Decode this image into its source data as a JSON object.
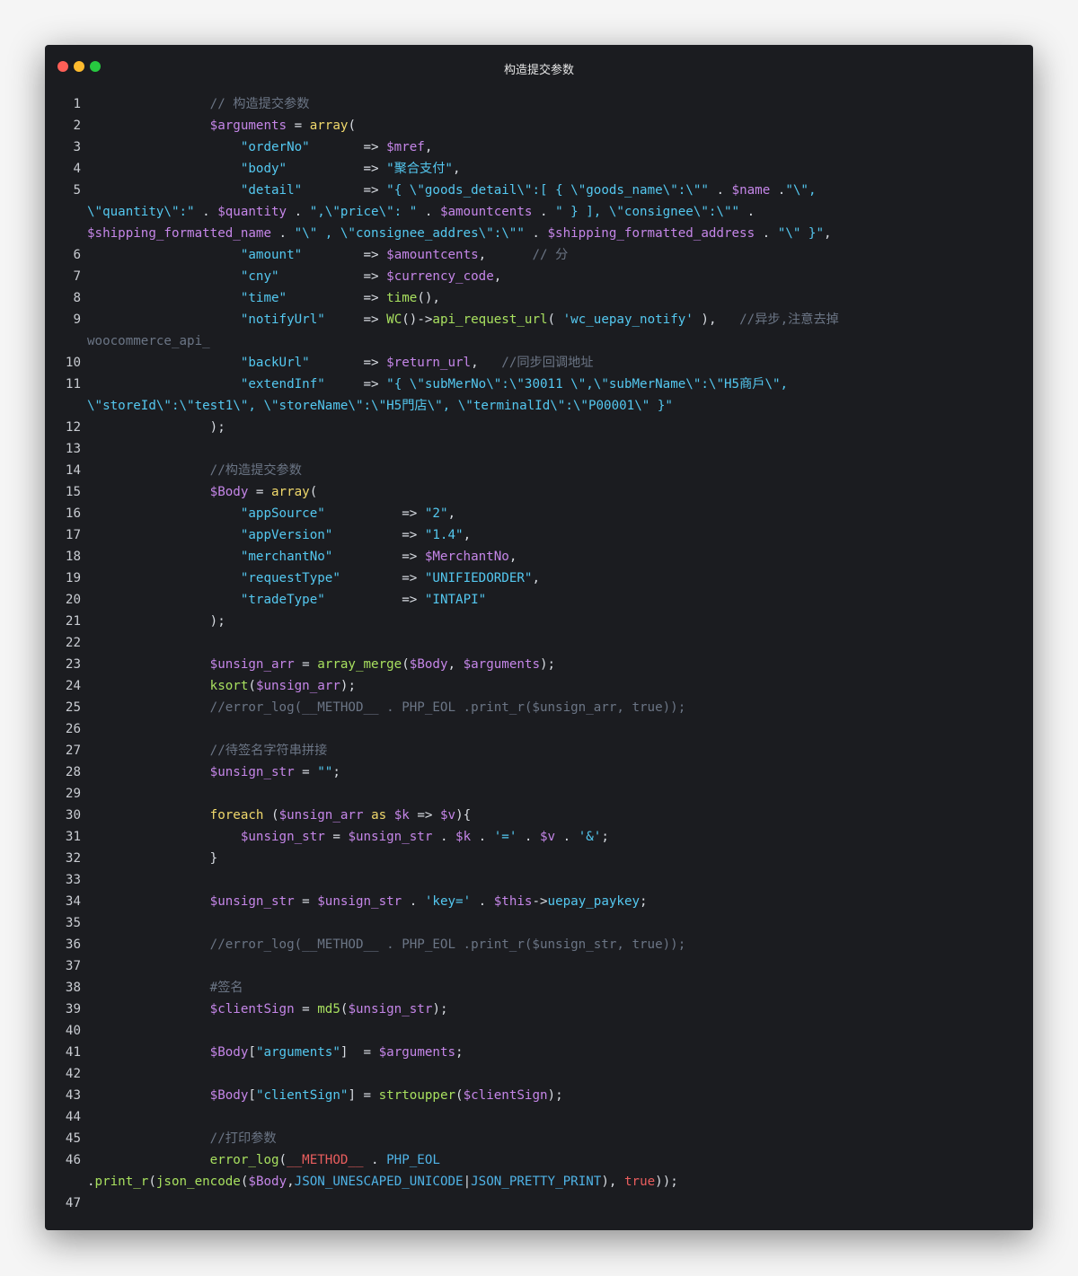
{
  "window": {
    "title": "构造提交参数",
    "colors": {
      "close": "#fe5f57",
      "minimize": "#febb2e",
      "maximize": "#27c840",
      "background": "#1b1c20"
    }
  },
  "code_lines": [
    {
      "n": "1",
      "tokens": [
        [
          "",
          "                "
        ],
        [
          "c",
          "// 构造提交参数"
        ]
      ]
    },
    {
      "n": "2",
      "tokens": [
        [
          "",
          "                "
        ],
        [
          "v",
          "$arguments"
        ],
        [
          "o",
          " = "
        ],
        [
          "k",
          "array"
        ],
        [
          "o",
          "("
        ]
      ]
    },
    {
      "n": "3",
      "tokens": [
        [
          "",
          "                    "
        ],
        [
          "s",
          "\"orderNo\""
        ],
        [
          "o",
          "       => "
        ],
        [
          "v",
          "$mref"
        ],
        [
          "o",
          ","
        ]
      ]
    },
    {
      "n": "4",
      "tokens": [
        [
          "",
          "                    "
        ],
        [
          "s",
          "\"body\""
        ],
        [
          "o",
          "          => "
        ],
        [
          "s",
          "\"聚合支付\""
        ],
        [
          "o",
          ","
        ]
      ]
    },
    {
      "n": "5",
      "tokens": [
        [
          "",
          "                    "
        ],
        [
          "s",
          "\"detail\""
        ],
        [
          "o",
          "        => "
        ],
        [
          "s",
          "\"{ \\\"goods_detail\\\":[ { \\\"goods_name\\\":\\\"\""
        ],
        [
          "o",
          " . "
        ],
        [
          "v",
          "$name"
        ],
        [
          "o",
          " ."
        ],
        [
          "s",
          "\"\\\","
        ]
      ]
    },
    {
      "n": "",
      "tokens": [
        [
          "s",
          "\\\"quantity\\\":\""
        ],
        [
          "o",
          " . "
        ],
        [
          "v",
          "$quantity"
        ],
        [
          "o",
          " . "
        ],
        [
          "s",
          "\",\\\"price\\\": \""
        ],
        [
          "o",
          " . "
        ],
        [
          "v",
          "$amountcents"
        ],
        [
          "o",
          " . "
        ],
        [
          "s",
          "\" } ], \\\"consignee\\\":\\\"\""
        ],
        [
          "o",
          " ."
        ]
      ]
    },
    {
      "n": "",
      "tokens": [
        [
          "v",
          "$shipping_formatted_name"
        ],
        [
          "o",
          " . "
        ],
        [
          "s",
          "\"\\\" , \\\"consignee_addres\\\":\\\"\""
        ],
        [
          "o",
          " . "
        ],
        [
          "v",
          "$shipping_formatted_address"
        ],
        [
          "o",
          " . "
        ],
        [
          "s",
          "\"\\\" }\""
        ],
        [
          "o",
          ","
        ]
      ]
    },
    {
      "n": "6",
      "tokens": [
        [
          "",
          "                    "
        ],
        [
          "s",
          "\"amount\""
        ],
        [
          "o",
          "        => "
        ],
        [
          "v",
          "$amountcents"
        ],
        [
          "o",
          ","
        ],
        [
          "",
          "      "
        ],
        [
          "c",
          "// 分"
        ]
      ]
    },
    {
      "n": "7",
      "tokens": [
        [
          "",
          "                    "
        ],
        [
          "s",
          "\"cny\""
        ],
        [
          "o",
          "           => "
        ],
        [
          "v",
          "$currency_code"
        ],
        [
          "o",
          ","
        ]
      ]
    },
    {
      "n": "8",
      "tokens": [
        [
          "",
          "                    "
        ],
        [
          "s",
          "\"time\""
        ],
        [
          "o",
          "          => "
        ],
        [
          "f",
          "time"
        ],
        [
          "o",
          "(),"
        ]
      ]
    },
    {
      "n": "9",
      "tokens": [
        [
          "",
          "                    "
        ],
        [
          "s",
          "\"notifyUrl\""
        ],
        [
          "o",
          "     => "
        ],
        [
          "f",
          "WC"
        ],
        [
          "o",
          "()->"
        ],
        [
          "f",
          "api_request_url"
        ],
        [
          "o",
          "( "
        ],
        [
          "s",
          "'wc_uepay_notify'"
        ],
        [
          "o",
          " ),"
        ],
        [
          "",
          "   "
        ],
        [
          "c",
          "//异步,注意去掉"
        ]
      ]
    },
    {
      "n": "",
      "tokens": [
        [
          "c",
          "woocommerce_api_"
        ]
      ]
    },
    {
      "n": "10",
      "tokens": [
        [
          "",
          "                    "
        ],
        [
          "s",
          "\"backUrl\""
        ],
        [
          "o",
          "       => "
        ],
        [
          "v",
          "$return_url"
        ],
        [
          "o",
          ","
        ],
        [
          "",
          "   "
        ],
        [
          "c",
          "//同步回调地址"
        ]
      ]
    },
    {
      "n": "11",
      "tokens": [
        [
          "",
          "                    "
        ],
        [
          "s",
          "\"extendInf\""
        ],
        [
          "o",
          "     => "
        ],
        [
          "s",
          "\"{ \\\"subMerNo\\\":\\\"30011 \\\",\\\"subMerName\\\":\\\"H5商戶\\\","
        ]
      ]
    },
    {
      "n": "",
      "tokens": [
        [
          "s",
          "\\\"storeId\\\":\\\"test1\\\", \\\"storeName\\\":\\\"H5門店\\\", \\\"terminalId\\\":\\\"P00001\\\" }\""
        ]
      ]
    },
    {
      "n": "12",
      "tokens": [
        [
          "",
          "                "
        ],
        [
          "o",
          ");"
        ]
      ]
    },
    {
      "n": "13",
      "tokens": []
    },
    {
      "n": "14",
      "tokens": [
        [
          "",
          "                "
        ],
        [
          "c",
          "//构造提交参数"
        ]
      ]
    },
    {
      "n": "15",
      "tokens": [
        [
          "",
          "                "
        ],
        [
          "v",
          "$Body"
        ],
        [
          "o",
          " = "
        ],
        [
          "k",
          "array"
        ],
        [
          "o",
          "("
        ]
      ]
    },
    {
      "n": "16",
      "tokens": [
        [
          "",
          "                    "
        ],
        [
          "s",
          "\"appSource\""
        ],
        [
          "o",
          "          => "
        ],
        [
          "s",
          "\"2\""
        ],
        [
          "o",
          ","
        ]
      ]
    },
    {
      "n": "17",
      "tokens": [
        [
          "",
          "                    "
        ],
        [
          "s",
          "\"appVersion\""
        ],
        [
          "o",
          "         => "
        ],
        [
          "s",
          "\"1.4\""
        ],
        [
          "o",
          ","
        ]
      ]
    },
    {
      "n": "18",
      "tokens": [
        [
          "",
          "                    "
        ],
        [
          "s",
          "\"merchantNo\""
        ],
        [
          "o",
          "         => "
        ],
        [
          "v",
          "$MerchantNo"
        ],
        [
          "o",
          ","
        ]
      ]
    },
    {
      "n": "19",
      "tokens": [
        [
          "",
          "                    "
        ],
        [
          "s",
          "\"requestType\""
        ],
        [
          "o",
          "        => "
        ],
        [
          "s",
          "\"UNIFIEDORDER\""
        ],
        [
          "o",
          ","
        ]
      ]
    },
    {
      "n": "20",
      "tokens": [
        [
          "",
          "                    "
        ],
        [
          "s",
          "\"tradeType\""
        ],
        [
          "o",
          "          => "
        ],
        [
          "s",
          "\"INTAPI\""
        ]
      ]
    },
    {
      "n": "21",
      "tokens": [
        [
          "",
          "                "
        ],
        [
          "o",
          ");"
        ]
      ]
    },
    {
      "n": "22",
      "tokens": []
    },
    {
      "n": "23",
      "tokens": [
        [
          "",
          "                "
        ],
        [
          "v",
          "$unsign_arr"
        ],
        [
          "o",
          " = "
        ],
        [
          "f",
          "array_merge"
        ],
        [
          "o",
          "("
        ],
        [
          "v",
          "$Body"
        ],
        [
          "o",
          ", "
        ],
        [
          "v",
          "$arguments"
        ],
        [
          "o",
          ");"
        ]
      ]
    },
    {
      "n": "24",
      "tokens": [
        [
          "",
          "                "
        ],
        [
          "f",
          "ksort"
        ],
        [
          "o",
          "("
        ],
        [
          "v",
          "$unsign_arr"
        ],
        [
          "o",
          ");"
        ]
      ]
    },
    {
      "n": "25",
      "tokens": [
        [
          "",
          "                "
        ],
        [
          "c",
          "//error_log(__METHOD__ . PHP_EOL .print_r($unsign_arr, true));"
        ]
      ]
    },
    {
      "n": "26",
      "tokens": []
    },
    {
      "n": "27",
      "tokens": [
        [
          "",
          "                "
        ],
        [
          "c",
          "//待签名字符串拼接"
        ]
      ]
    },
    {
      "n": "28",
      "tokens": [
        [
          "",
          "                "
        ],
        [
          "v",
          "$unsign_str"
        ],
        [
          "o",
          " = "
        ],
        [
          "s",
          "\"\""
        ],
        [
          "o",
          ";"
        ]
      ]
    },
    {
      "n": "29",
      "tokens": []
    },
    {
      "n": "30",
      "tokens": [
        [
          "",
          "                "
        ],
        [
          "k",
          "foreach"
        ],
        [
          "o",
          " ("
        ],
        [
          "v",
          "$unsign_arr"
        ],
        [
          "o",
          " "
        ],
        [
          "k",
          "as"
        ],
        [
          "o",
          " "
        ],
        [
          "v",
          "$k"
        ],
        [
          "o",
          " => "
        ],
        [
          "v",
          "$v"
        ],
        [
          "o",
          "){"
        ]
      ]
    },
    {
      "n": "31",
      "tokens": [
        [
          "",
          "                    "
        ],
        [
          "v",
          "$unsign_str"
        ],
        [
          "o",
          " = "
        ],
        [
          "v",
          "$unsign_str"
        ],
        [
          "o",
          " . "
        ],
        [
          "v",
          "$k"
        ],
        [
          "o",
          " . "
        ],
        [
          "s",
          "'='"
        ],
        [
          "o",
          " . "
        ],
        [
          "v",
          "$v"
        ],
        [
          "o",
          " . "
        ],
        [
          "s",
          "'&'"
        ],
        [
          "o",
          ";"
        ]
      ]
    },
    {
      "n": "32",
      "tokens": [
        [
          "",
          "                "
        ],
        [
          "o",
          "}"
        ]
      ]
    },
    {
      "n": "33",
      "tokens": []
    },
    {
      "n": "34",
      "tokens": [
        [
          "",
          "                "
        ],
        [
          "v",
          "$unsign_str"
        ],
        [
          "o",
          " = "
        ],
        [
          "v",
          "$unsign_str"
        ],
        [
          "o",
          " . "
        ],
        [
          "s",
          "'key='"
        ],
        [
          "o",
          " . "
        ],
        [
          "v",
          "$this"
        ],
        [
          "o",
          "->"
        ],
        [
          "s",
          "uepay_paykey"
        ],
        [
          "o",
          ";"
        ]
      ]
    },
    {
      "n": "35",
      "tokens": []
    },
    {
      "n": "36",
      "tokens": [
        [
          "",
          "                "
        ],
        [
          "c",
          "//error_log(__METHOD__ . PHP_EOL .print_r($unsign_str, true));"
        ]
      ]
    },
    {
      "n": "37",
      "tokens": []
    },
    {
      "n": "38",
      "tokens": [
        [
          "",
          "                "
        ],
        [
          "c",
          "#签名"
        ]
      ]
    },
    {
      "n": "39",
      "tokens": [
        [
          "",
          "                "
        ],
        [
          "v",
          "$clientSign"
        ],
        [
          "o",
          " = "
        ],
        [
          "f",
          "md5"
        ],
        [
          "o",
          "("
        ],
        [
          "v",
          "$unsign_str"
        ],
        [
          "o",
          ");"
        ]
      ]
    },
    {
      "n": "40",
      "tokens": []
    },
    {
      "n": "41",
      "tokens": [
        [
          "",
          "                "
        ],
        [
          "v",
          "$Body"
        ],
        [
          "o",
          "["
        ],
        [
          "s",
          "\"arguments\""
        ],
        [
          "o",
          "]  = "
        ],
        [
          "v",
          "$arguments"
        ],
        [
          "o",
          ";"
        ]
      ]
    },
    {
      "n": "42",
      "tokens": []
    },
    {
      "n": "43",
      "tokens": [
        [
          "",
          "                "
        ],
        [
          "v",
          "$Body"
        ],
        [
          "o",
          "["
        ],
        [
          "s",
          "\"clientSign\""
        ],
        [
          "o",
          "] = "
        ],
        [
          "f",
          "strtoupper"
        ],
        [
          "o",
          "("
        ],
        [
          "v",
          "$clientSign"
        ],
        [
          "o",
          ");"
        ]
      ]
    },
    {
      "n": "44",
      "tokens": []
    },
    {
      "n": "45",
      "tokens": [
        [
          "",
          "                "
        ],
        [
          "c",
          "//打印参数"
        ]
      ]
    },
    {
      "n": "46",
      "tokens": [
        [
          "",
          "                "
        ],
        [
          "f",
          "error_log"
        ],
        [
          "o",
          "("
        ],
        [
          "m",
          "__METHOD__"
        ],
        [
          "o",
          " . "
        ],
        [
          "cn",
          "PHP_EOL"
        ]
      ]
    },
    {
      "n": "",
      "tokens": [
        [
          "o",
          "."
        ],
        [
          "f",
          "print_r"
        ],
        [
          "o",
          "("
        ],
        [
          "f",
          "json_encode"
        ],
        [
          "o",
          "("
        ],
        [
          "v",
          "$Body"
        ],
        [
          "o",
          ","
        ],
        [
          "cn",
          "JSON_UNESCAPED_UNICODE"
        ],
        [
          "o",
          "|"
        ],
        [
          "cn",
          "JSON_PRETTY_PRINT"
        ],
        [
          "o",
          "), "
        ],
        [
          "m",
          "true"
        ],
        [
          "o",
          "));"
        ]
      ]
    },
    {
      "n": "47",
      "tokens": []
    }
  ]
}
